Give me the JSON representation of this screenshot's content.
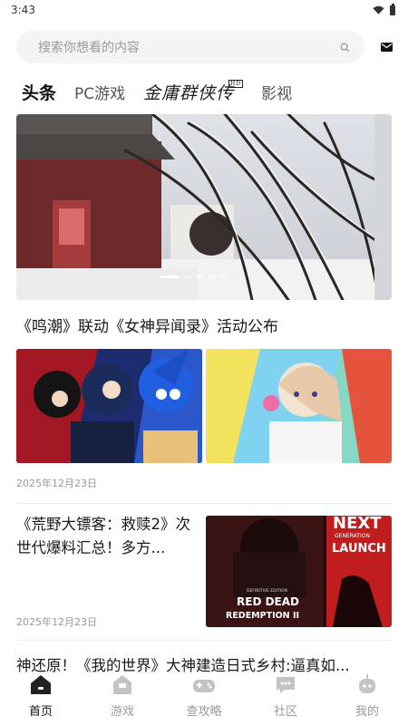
{
  "status_bar": {
    "time": "3:43"
  },
  "search": {
    "placeholder": "搜索你想看的内容"
  },
  "tabs": [
    {
      "label": "头条",
      "active": true
    },
    {
      "label": "PC游戏",
      "active": false
    },
    {
      "label": "金庸群侠传",
      "logo": true,
      "badge": "HD"
    },
    {
      "label": "影视",
      "active": false
    }
  ],
  "banner": {
    "slide_count": 5,
    "active_slide": 1
  },
  "headline": {
    "title": "《鸣潮》联动《女神异闻录》活动公布"
  },
  "article1": {
    "date": "2025年12月23日"
  },
  "article2": {
    "title": "《荒野大镖客：救赎2》次世代爆料汇总！多方...",
    "date": "2025年12月23日",
    "image_text_1": "RED DEAD",
    "image_text_2": "REDEMPTION II",
    "image_text_3": "DEFINITIVE EDITION",
    "image_text_4": "NEXT",
    "image_text_5": "GENERATION",
    "image_text_6": "LAUNCH"
  },
  "article3": {
    "title": "神还原！《我的世界》大神建造日式乡村:逼真如..."
  },
  "bottom_nav": [
    {
      "label": "首页",
      "icon": "home-icon",
      "active": true
    },
    {
      "label": "游戏",
      "icon": "game-store-icon",
      "active": false
    },
    {
      "label": "查攻略",
      "icon": "gamepad-icon",
      "active": false
    },
    {
      "label": "社区",
      "icon": "chat-bubble-icon",
      "active": false
    },
    {
      "label": "我的",
      "icon": "robot-profile-icon",
      "active": false
    }
  ],
  "colors": {
    "accent_text": "#111111",
    "muted_text": "#9a9a9a",
    "search_bg": "#f3f4f6"
  }
}
